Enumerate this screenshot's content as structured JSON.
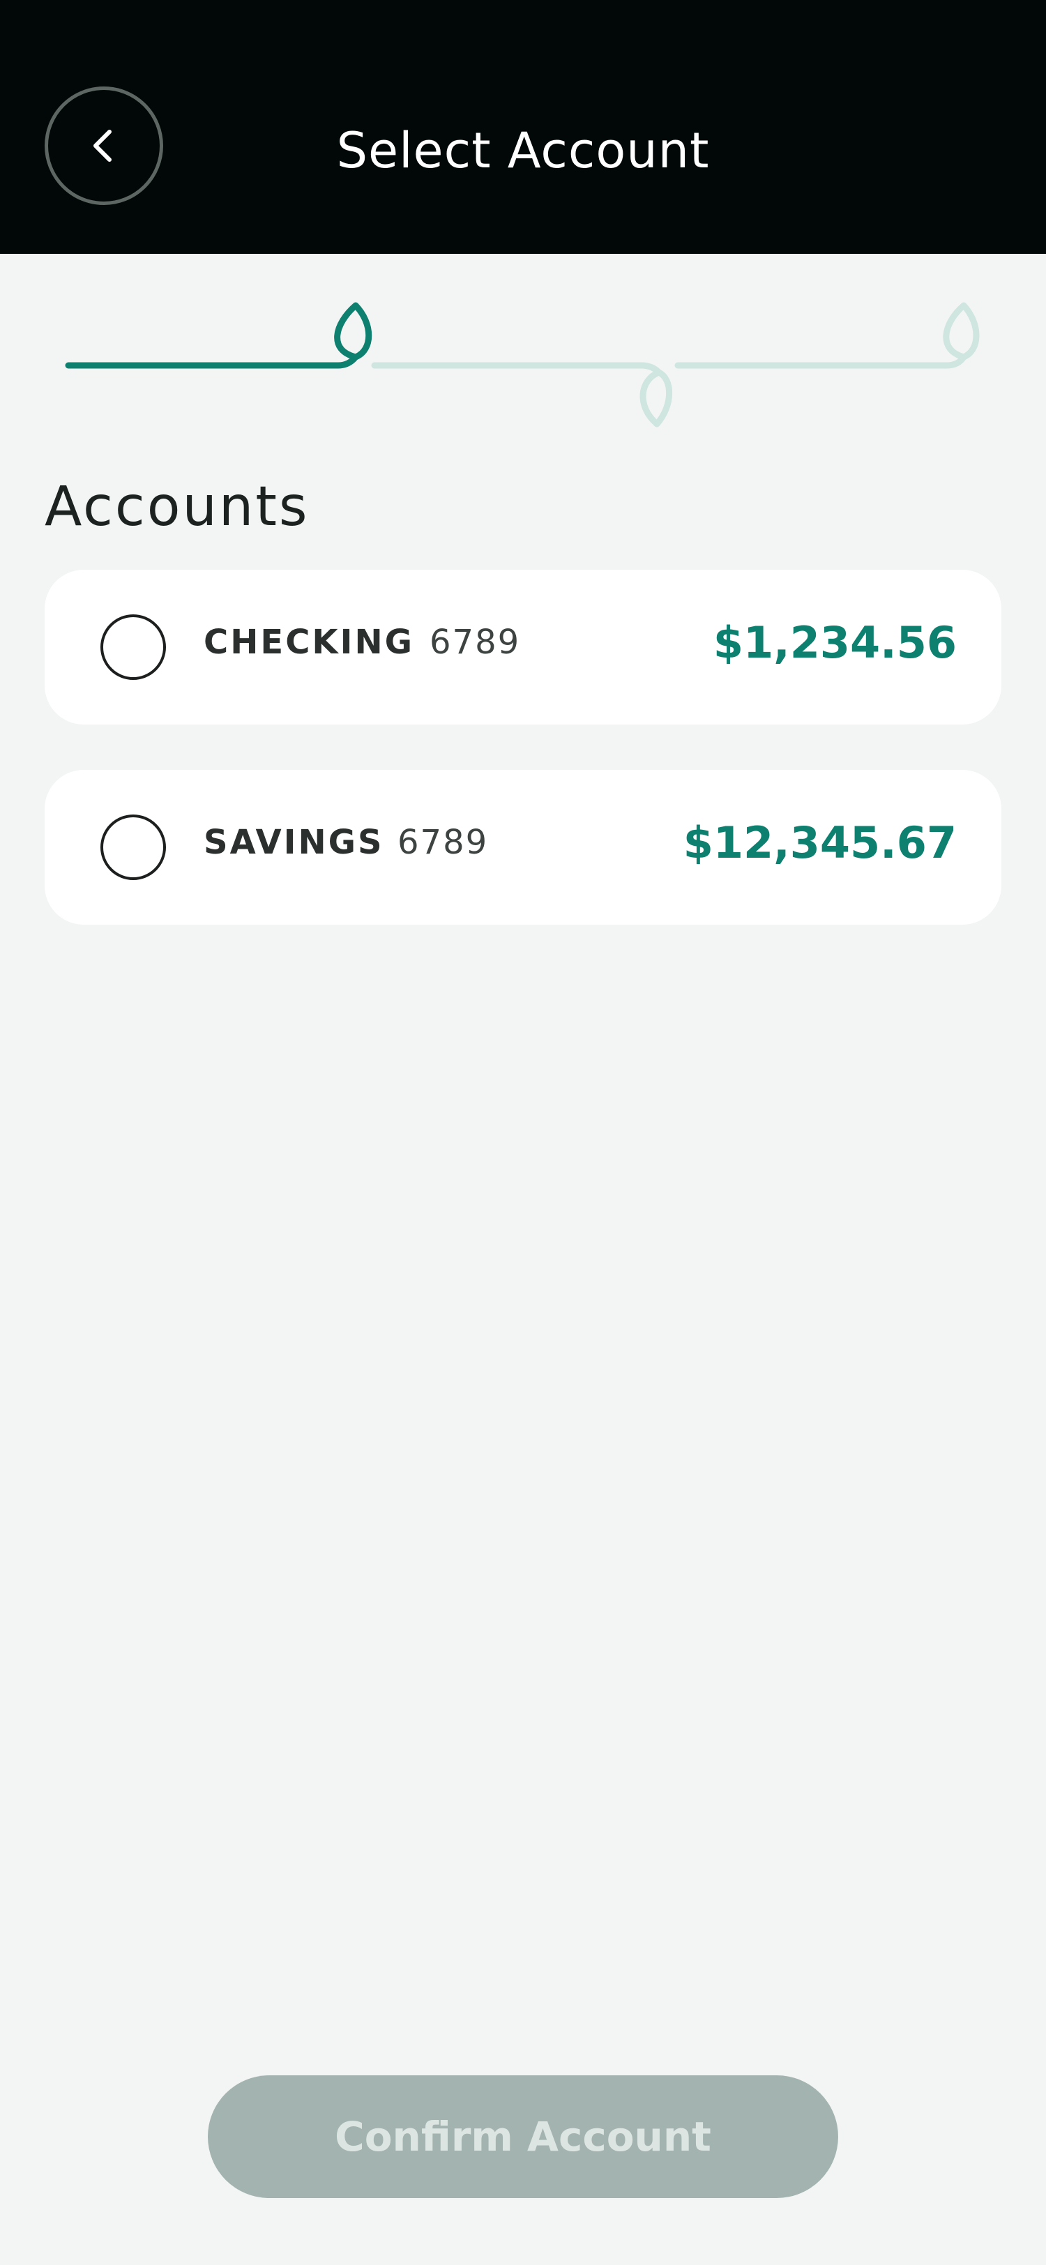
{
  "header": {
    "title": "Select Account",
    "back_icon": "chevron-left-icon"
  },
  "progress": {
    "current_step": 1,
    "total_steps": 3,
    "active_color": "#0d8070",
    "inactive_color": "#cfe5df"
  },
  "accounts_section": {
    "title": "Accounts",
    "items": [
      {
        "name": "CHECKING",
        "mask": "6789",
        "balance": "$1,234.56",
        "selected": false
      },
      {
        "name": "SAVINGS",
        "mask": "6789",
        "balance": "$12,345.67",
        "selected": false
      }
    ]
  },
  "footer": {
    "confirm_label": "Confirm Account",
    "confirm_enabled": false
  },
  "colors": {
    "header_bg": "#020807",
    "page_bg": "#f3f5f4",
    "accent": "#0d8070",
    "disabled_button": "#a3b4b0"
  }
}
